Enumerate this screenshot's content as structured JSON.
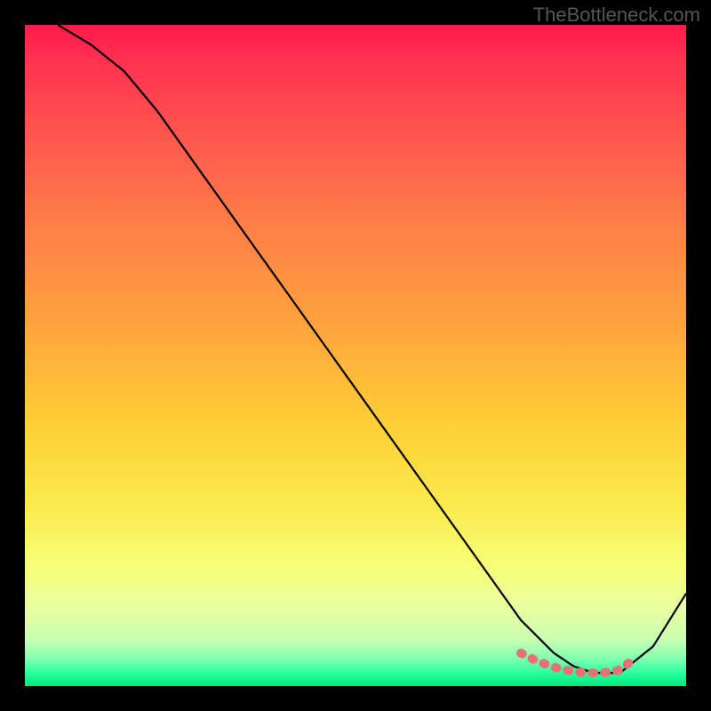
{
  "watermark": "TheBottleneck.com",
  "chart_data": {
    "type": "line",
    "title": "",
    "xlabel": "",
    "ylabel": "",
    "xlim": [
      0,
      100
    ],
    "ylim": [
      0,
      100
    ],
    "series": [
      {
        "name": "curve",
        "color": "#000000",
        "x": [
          5,
          10,
          15,
          20,
          25,
          30,
          35,
          40,
          45,
          50,
          55,
          60,
          65,
          70,
          75,
          80,
          83,
          86,
          90,
          95,
          100
        ],
        "values": [
          100,
          97,
          93,
          87,
          80,
          73,
          66,
          59,
          52,
          45,
          38,
          31,
          24,
          17,
          10,
          5,
          3,
          2,
          2,
          6,
          14
        ]
      },
      {
        "name": "flat-dots",
        "color": "#e57373",
        "type": "scatter",
        "x": [
          75,
          77,
          79,
          81,
          83,
          85,
          87,
          89,
          90,
          91,
          92
        ],
        "values": [
          5,
          4,
          3.2,
          2.6,
          2.2,
          2,
          2,
          2.2,
          2.5,
          3.2,
          4.2
        ]
      }
    ],
    "background_gradient": {
      "top": "#ff1a4a",
      "mid": "#ffe14a",
      "bottom": "#00e878"
    }
  }
}
